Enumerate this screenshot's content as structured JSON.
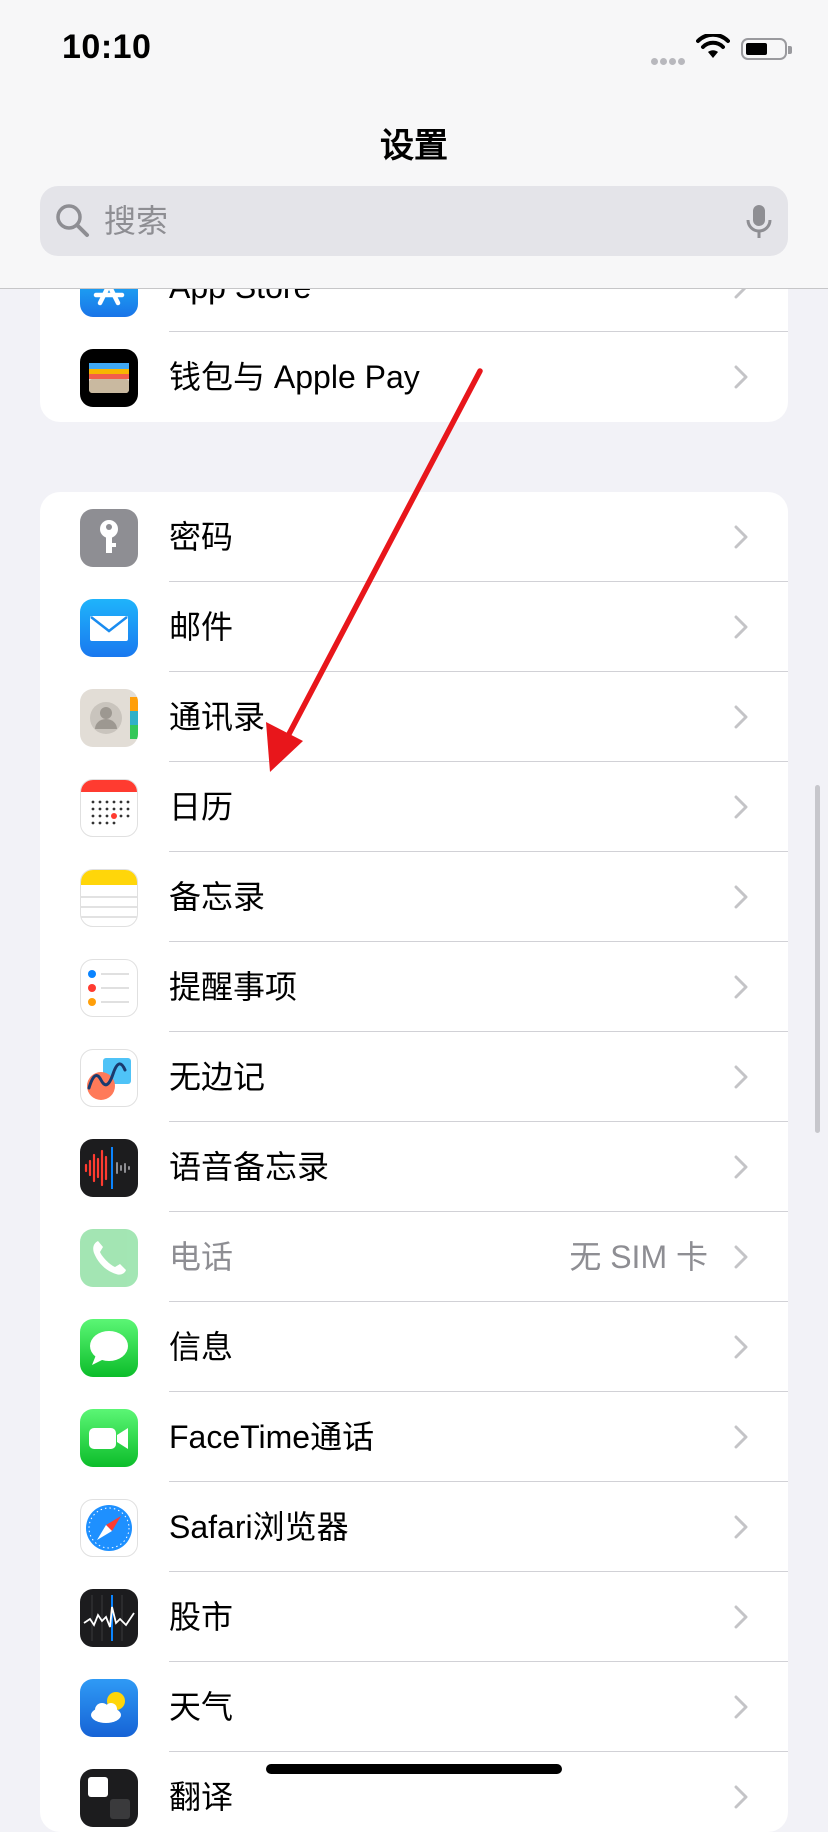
{
  "status_bar": {
    "time": "10:10"
  },
  "header": {
    "title": "设置"
  },
  "search": {
    "placeholder": "搜索"
  },
  "group_top": [
    {
      "label": "App Store",
      "icon": "app-store-icon"
    },
    {
      "label": "钱包与 Apple Pay",
      "icon": "wallet-icon"
    }
  ],
  "group_main": [
    {
      "label": "密码",
      "icon": "key-icon"
    },
    {
      "label": "邮件",
      "icon": "mail-icon"
    },
    {
      "label": "通讯录",
      "icon": "contacts-icon"
    },
    {
      "label": "日历",
      "icon": "calendar-icon"
    },
    {
      "label": "备忘录",
      "icon": "notes-icon"
    },
    {
      "label": "提醒事项",
      "icon": "reminders-icon"
    },
    {
      "label": "无边记",
      "icon": "freeform-icon"
    },
    {
      "label": "语音备忘录",
      "icon": "voice-memos-icon"
    },
    {
      "label": "电话",
      "detail": "无 SIM 卡",
      "icon": "phone-icon"
    },
    {
      "label": "信息",
      "icon": "messages-icon"
    },
    {
      "label": "FaceTime通话",
      "icon": "facetime-icon"
    },
    {
      "label": "Safari浏览器",
      "icon": "safari-icon"
    },
    {
      "label": "股市",
      "icon": "stocks-icon"
    },
    {
      "label": "天气",
      "icon": "weather-icon"
    },
    {
      "label": "翻译",
      "icon": "translate-icon"
    }
  ],
  "colors": {
    "annotation_arrow": "#e8161b",
    "accent": "#007aff"
  }
}
